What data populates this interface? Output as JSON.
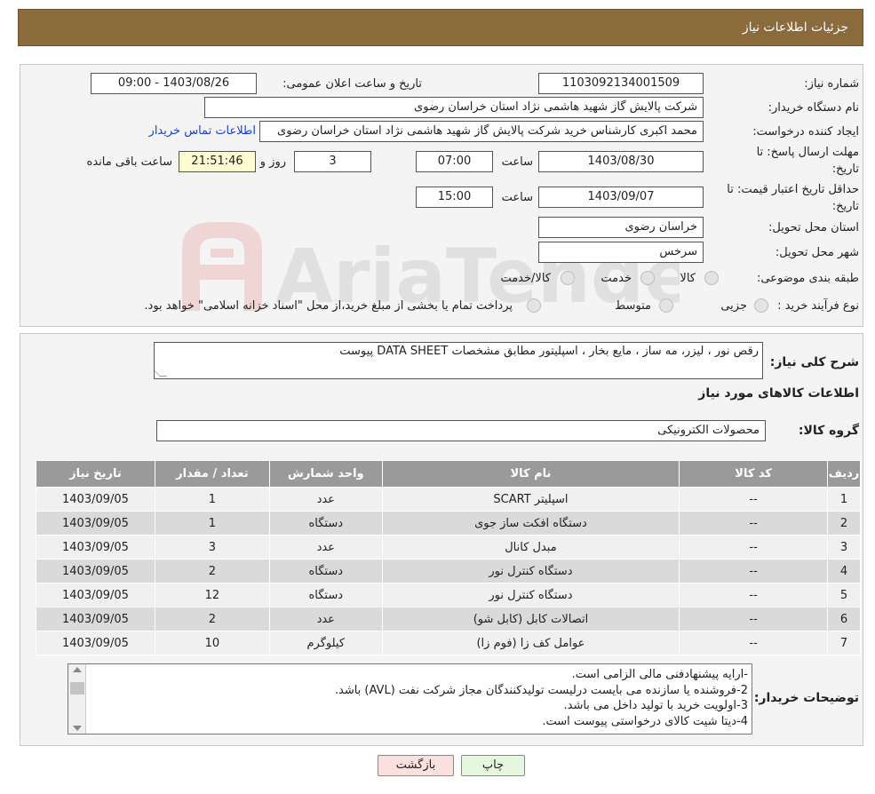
{
  "header": {
    "title": "جزئیات اطلاعات نیاز"
  },
  "info": {
    "need_number_label": "شماره نیاز:",
    "need_number": "1103092134001509",
    "announce_label": "تاریخ و ساعت اعلان عمومی:",
    "announce_value": "1403/08/26 - 09:00",
    "buyer_org_label": "نام دستگاه خریدار:",
    "buyer_org": "شرکت پالایش گاز شهید هاشمی نژاد   استان خراسان رضوی",
    "creator_label": "ایجاد کننده درخواست:",
    "creator": "محمد اکبری کارشناس خرید شرکت پالایش گاز شهید هاشمی نژاد   استان خراسان رضوی",
    "contact_link": "اطلاعات تماس خریدار",
    "deadline_label_1": "مهلت ارسال پاسخ: تا",
    "deadline_label_2": "تاریخ:",
    "deadline_date": "1403/08/30",
    "time_label": "ساعت",
    "deadline_time": "07:00",
    "days_value": "3",
    "days_label": "روز و",
    "remaining_time": "21:51:46",
    "remaining_label": "ساعت باقی مانده",
    "validity_label_1": "حداقل تاریخ اعتبار قیمت: تا",
    "validity_label_2": "تاریخ:",
    "validity_date": "1403/09/07",
    "validity_time_label": "ساعت",
    "validity_time": "15:00",
    "province_label": "استان محل تحویل:",
    "province": "خراسان رضوی",
    "city_label": "شهر محل تحویل:",
    "city": "سرخس",
    "category_label": "طبقه بندی موضوعی:",
    "category_options": [
      "کالا",
      "خدمت",
      "کالا/خدمت"
    ],
    "process_label": "نوع فرآیند خرید :",
    "process_options": [
      "جزیی",
      "متوسط"
    ],
    "process_note": "پرداخت تمام یا بخشی از مبلغ خرید،از محل \"اسناد خزانه اسلامی\" خواهد بود."
  },
  "description": {
    "summary_label": "شرح کلی نیاز:",
    "summary": "رقص نور ، لیزر، مه ساز ، مایع بخار ، اسپلیتور مطابق مشخصات DATA SHEET پیوست",
    "goods_info_title": "اطلاعات کالاهای مورد نیاز",
    "goods_group_label": "گروه کالا:",
    "goods_group": "محصولات الکترونیکی"
  },
  "table": {
    "headers": [
      "ردیف",
      "کد کالا",
      "نام کالا",
      "واحد شمارش",
      "تعداد / مقدار",
      "تاریخ نیاز"
    ],
    "rows": [
      [
        "1",
        "--",
        "اسپلیتر SCART",
        "عدد",
        "1",
        "1403/09/05"
      ],
      [
        "2",
        "--",
        "دستگاه افکت ساز جوی",
        "دستگاه",
        "1",
        "1403/09/05"
      ],
      [
        "3",
        "--",
        "مبدل کانال",
        "عدد",
        "3",
        "1403/09/05"
      ],
      [
        "4",
        "--",
        "دستگاه کنترل نور",
        "دستگاه",
        "2",
        "1403/09/05"
      ],
      [
        "5",
        "--",
        "دستگاه کنترل نور",
        "دستگاه",
        "12",
        "1403/09/05"
      ],
      [
        "6",
        "--",
        "اتصالات کابل (کابل شو)",
        "عدد",
        "2",
        "1403/09/05"
      ],
      [
        "7",
        "--",
        "عوامل کف زا (فوم زا)",
        "کیلوگرم",
        "10",
        "1403/09/05"
      ]
    ]
  },
  "notes": {
    "label": "توضیحات خریدار:",
    "lines": [
      "-ارایه پیشنهادفنی مالی الزامی است.",
      "2-فروشنده یا سازنده می بایست درلیست تولیدکنندگان مجاز شرکت نفت (AVL)  باشد.",
      "3-اولویت خرید با  تولید داخل می باشد.",
      "4-دیتا شیت کالای درخواستی پیوست است."
    ]
  },
  "buttons": {
    "print": "چاپ",
    "back": "بازگشت"
  },
  "watermark_text": "AriaTender.neT",
  "colors": {
    "header": "#8b6a3c",
    "link": "#1a3fd1",
    "table_header": "#9a9a9a"
  }
}
